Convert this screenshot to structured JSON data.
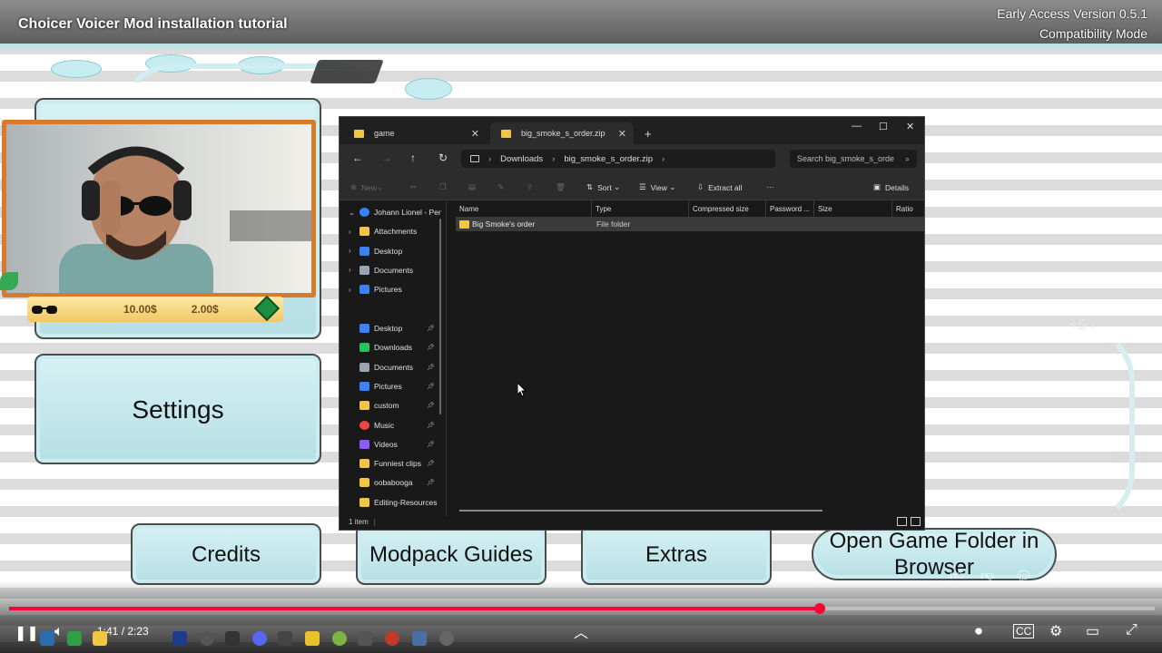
{
  "video": {
    "title": "Choicer Voicer Mod installation tutorial",
    "time": "1:41 / 2:23",
    "progress_fraction": 0.708
  },
  "game": {
    "version_line1": "Early Access Version 0.5.1",
    "version_line2": "Compatibility Mode",
    "buttons": {
      "settings": "Settings",
      "credits": "Credits",
      "modpack_guides": "Modpack Guides",
      "extras": "Extras",
      "open_folder": "Open Game Folder in Browser"
    },
    "page_hint": "5",
    "hud_money_1": "10.00$",
    "hud_money_2": "2.00$"
  },
  "explorer": {
    "tabs": [
      {
        "label": "game"
      },
      {
        "label": "big_smoke_s_order.zip"
      }
    ],
    "new_tab": "+",
    "breadcrumb": [
      "Downloads",
      "big_smoke_s_order.zip"
    ],
    "search_placeholder": "Search big_smoke_s_orde",
    "commands": {
      "new": "New",
      "sort": "Sort",
      "view": "View",
      "extract_all": "Extract all",
      "more": "···",
      "details": "Details"
    },
    "nav_tree": [
      {
        "label": "Johann Lionel - Per",
        "type": "cloud"
      },
      {
        "label": "Attachments",
        "type": "folder"
      },
      {
        "label": "Desktop",
        "type": "desktop"
      },
      {
        "label": "Documents",
        "type": "docs"
      },
      {
        "label": "Pictures",
        "type": "pictures"
      }
    ],
    "quick_access": [
      {
        "label": "Desktop",
        "type": "desktop"
      },
      {
        "label": "Downloads",
        "type": "downloads"
      },
      {
        "label": "Documents",
        "type": "docs"
      },
      {
        "label": "Pictures",
        "type": "pictures"
      },
      {
        "label": "custom",
        "type": "folder"
      },
      {
        "label": "Music",
        "type": "music"
      },
      {
        "label": "Videos",
        "type": "videos"
      },
      {
        "label": "Funniest clips",
        "type": "folder"
      },
      {
        "label": "oobabooga",
        "type": "folder"
      },
      {
        "label": "Editing-Resources",
        "type": "folder"
      }
    ],
    "columns": [
      "Name",
      "Type",
      "Compressed size",
      "Password ...",
      "Size",
      "Ratio"
    ],
    "files": [
      {
        "name": "Big Smoke's order",
        "type": "File folder"
      }
    ],
    "status": "1 item"
  },
  "colors": {
    "accent_red": "#ff0033",
    "explorer_bg": "#1f1f1f",
    "folder_yellow": "#f2c545",
    "menu_button": "#b5dfe4"
  }
}
